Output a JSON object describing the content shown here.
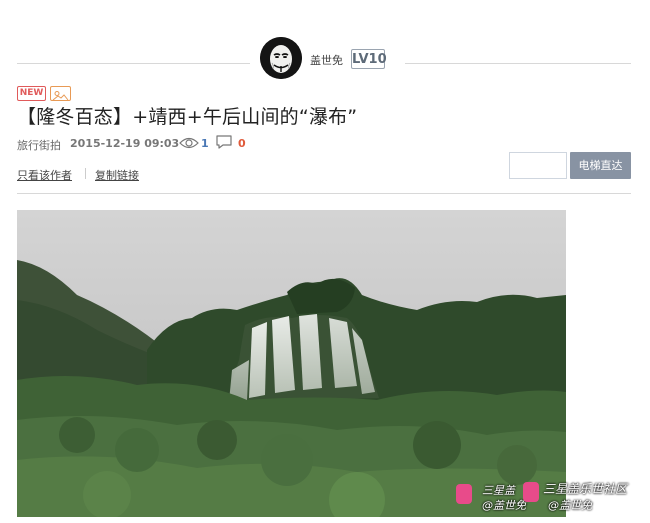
{
  "author": {
    "name": "盖世免",
    "level": "LV10"
  },
  "post": {
    "badge_new": "NEW",
    "title": "【隆冬百态】+靖西+午后山间的“瀑布”",
    "category": "旅行街拍",
    "datetime": "2015-12-19 09:03",
    "views": "1",
    "comments": "0"
  },
  "actions": {
    "only_author": "只看该作者",
    "copy_link": "复制链接",
    "jump_button": "电梯直达",
    "jump_input_value": ""
  },
  "watermark": {
    "line1_left": "三星盖",
    "line2_left": "@盖世免",
    "line1_right": "三星盖乐世社区",
    "line2_right": "@盖世免"
  },
  "icons": {
    "views": "eye-icon",
    "comments": "comment-bubble-icon",
    "image_badge": "image-icon"
  }
}
